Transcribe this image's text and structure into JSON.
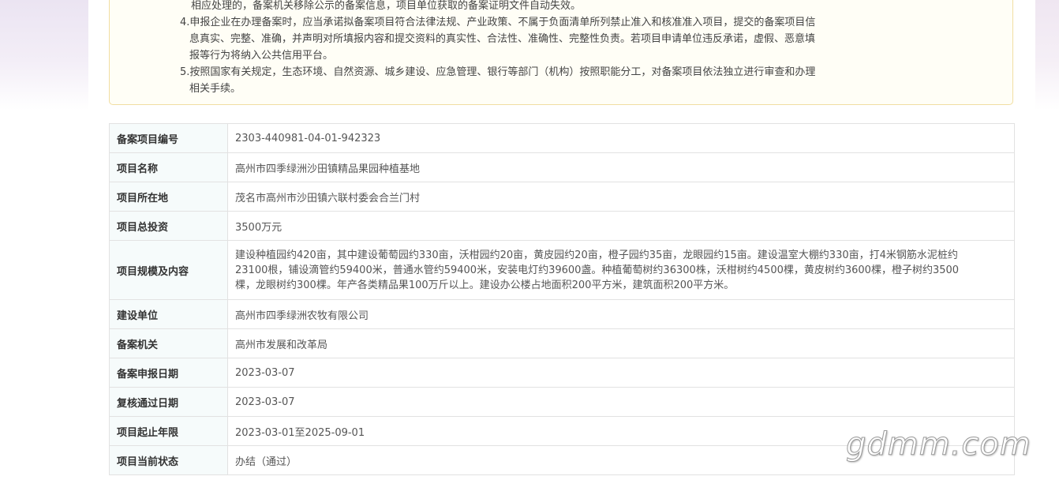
{
  "notice": {
    "lines": [
      "相应处理的，备案机关移除公示的备案信息，项目单位获取的备案证明文件自动失效。",
      "4.申报企业在办理备案时，应当承诺拟备案项目符合法律法规、产业政策、不属于负面清单所列禁止准入和核准准入项目，提交的备案项目信",
      "息真实、完整、准确，并声明对所填报内容和提交资料的真实性、合法性、准确性、完整性负责。若项目申请单位违反承诺，虚假、恶意填",
      "报等行为将纳入公共信用平台。",
      "5.按照国家有关规定，生态环境、自然资源、城乡建设、应急管理、银行等部门（机构）按照职能分工，对备案项目依法独立进行审查和办理",
      "相关手续。"
    ]
  },
  "project": {
    "rows": [
      {
        "label": "备案项目编号",
        "value": "2303-440981-04-01-942323"
      },
      {
        "label": "项目名称",
        "value": "高州市四季绿洲沙田镇精品果园种植基地"
      },
      {
        "label": "项目所在地",
        "value": "茂名市高州市沙田镇六联村委会合兰门村"
      },
      {
        "label": "项目总投资",
        "value": "3500万元"
      },
      {
        "label": "项目规模及内容",
        "value_lines": [
          "建设种植园约420亩，其中建设葡萄园约330亩，沃柑园约20亩，黄皮园约20亩，橙子园约35亩，龙眼园约15亩。建设温室大棚约330亩，打4米钢筋水泥桩约",
          "23100根，铺设滴管约59400米，普通水管约59400米，安装电灯约39600盏。种植葡萄树约36300株，沃柑树约4500棵，黄皮树约3600棵，橙子树约3500",
          "棵，龙眼树约300棵。年产各类精品果100万斤以上。建设办公楼占地面积200平方米，建筑面积200平方米。"
        ]
      },
      {
        "label": "建设单位",
        "value": "高州市四季绿洲农牧有限公司"
      },
      {
        "label": "备案机关",
        "value": "高州市发展和改革局"
      },
      {
        "label": "备案申报日期",
        "value": "2023-03-07"
      },
      {
        "label": "复核通过日期",
        "value": "2023-03-07"
      },
      {
        "label": "项目起止年限",
        "value": "2023-03-01至2025-09-01"
      },
      {
        "label": "项目当前状态",
        "value": "办结（通过）"
      }
    ]
  },
  "watermark": "gdmm.com"
}
